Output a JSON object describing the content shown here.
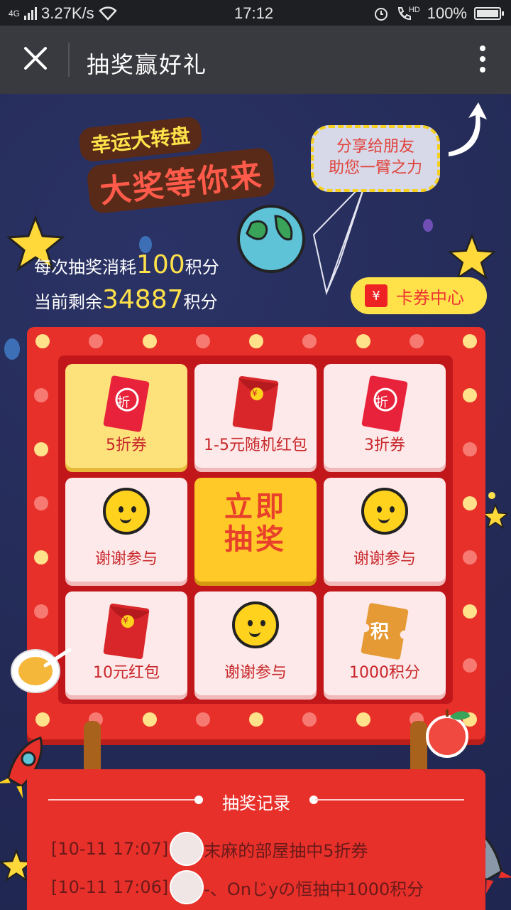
{
  "status_bar": {
    "network": "4G",
    "speed": "3.27K/s",
    "time": "17:12",
    "call_badge": "HD",
    "battery": "100%"
  },
  "app_bar": {
    "title": "抽奖赢好礼"
  },
  "hero": {
    "banner_line1": "幸运大转盘",
    "banner_line2": "大奖等你来",
    "share_line1": "分享给朋友",
    "share_line2": "助您一臂之力"
  },
  "points": {
    "cost_prefix": "每次抽奖消耗",
    "cost_value": "100",
    "cost_suffix": "积分",
    "remain_prefix": "当前剩余",
    "remain_value": "34887",
    "remain_suffix": "积分"
  },
  "coupon_center": {
    "icon": "¥",
    "label": "卡券中心"
  },
  "prizes": [
    {
      "label": "5折券",
      "icon": "discount-ticket-icon",
      "glyph": "折"
    },
    {
      "label": "1-5元随机红包",
      "icon": "red-envelope-icon",
      "glyph": "¥"
    },
    {
      "label": "3折券",
      "icon": "discount-ticket-icon",
      "glyph": "折"
    },
    {
      "label": "谢谢参与",
      "icon": "smiley-icon"
    },
    {
      "label": "谢谢参与",
      "icon": "smiley-icon"
    },
    {
      "label": "10元红包",
      "icon": "red-envelope-icon",
      "glyph": "¥"
    },
    {
      "label": "谢谢参与",
      "icon": "smiley-icon"
    },
    {
      "label": "1000积分",
      "icon": "points-ticket-icon",
      "glyph": "积"
    }
  ],
  "draw_button": {
    "line1": "立即",
    "line2": "抽奖"
  },
  "records": {
    "title": "抽奖记录",
    "items": [
      {
        "time": "[10-11 17:07]",
        "text": "末麻的部屋抽中5折券"
      },
      {
        "time": "[10-11 17:06]",
        "text": "-、Onじyの恒抽中1000积分"
      }
    ]
  },
  "colors": {
    "background": "#232a55",
    "board_red": "#e8302a",
    "accent_yellow": "#ffe24a",
    "active_cell": "#fde27c"
  }
}
